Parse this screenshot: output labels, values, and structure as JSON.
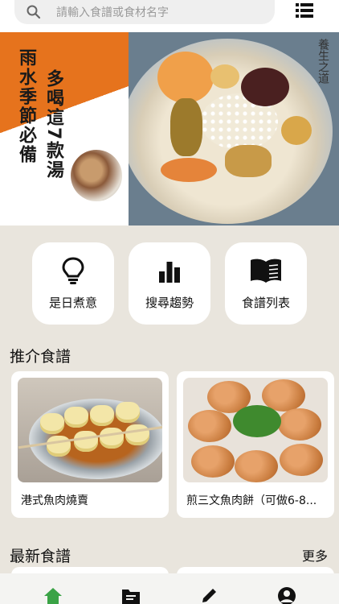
{
  "search": {
    "placeholder": "請輸入食譜或食材名字"
  },
  "banner": {
    "headline_left": "雨水季節必備",
    "headline_right": "多喝這7款湯",
    "signature": "養生之道",
    "slide_count": 4,
    "active_slide_index": 2
  },
  "quick_actions": [
    {
      "label": "是日煮意",
      "icon": "lightbulb-icon"
    },
    {
      "label": "搜尋趨勢",
      "icon": "bar-chart-icon"
    },
    {
      "label": "食譜列表",
      "icon": "book-icon"
    }
  ],
  "recommended": {
    "title": "推介食譜",
    "items": [
      {
        "title": "港式魚肉燒賣"
      },
      {
        "title": "煎三文魚肉餅（可做6-8..."
      }
    ]
  },
  "latest": {
    "title": "最新食譜",
    "more_label": "更多"
  },
  "tabbar": {
    "tabs": [
      {
        "name": "home",
        "icon": "home-icon",
        "active": true
      },
      {
        "name": "recipes",
        "icon": "folder-icon",
        "active": false
      },
      {
        "name": "write",
        "icon": "pencil-icon",
        "active": false
      },
      {
        "name": "profile",
        "icon": "user-icon",
        "active": false
      }
    ]
  },
  "colors": {
    "accent": "#3aa346",
    "background": "#e9e5dd",
    "banner_orange": "#e6731d"
  }
}
